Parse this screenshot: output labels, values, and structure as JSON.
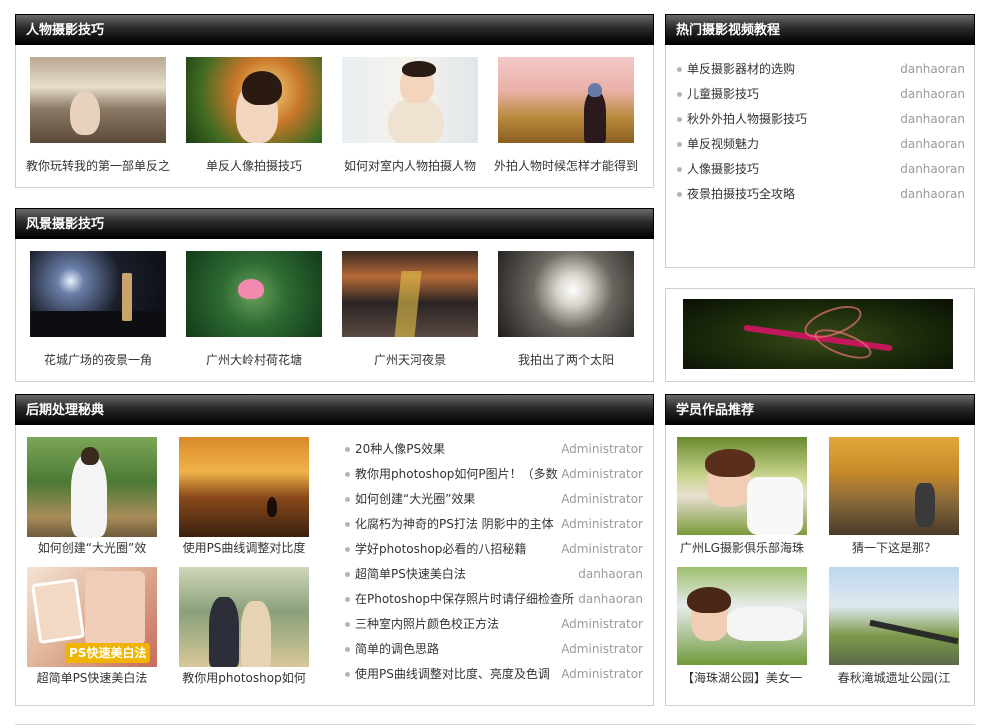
{
  "portrait": {
    "title": "人物摄影技巧",
    "items": [
      {
        "caption": "教你玩转我的第一部单反之",
        "img": "woman-on-beach-photo"
      },
      {
        "caption": "单反人像拍摄技巧",
        "img": "woman-in-autumn-leaves-photo"
      },
      {
        "caption": "如何对室内人物拍摄人物",
        "img": "woman-indoor-portrait-photo"
      },
      {
        "caption": "外拍人物时候怎样才能得到",
        "img": "woman-in-wheat-field-photo"
      }
    ]
  },
  "landscape": {
    "title": "风景摄影技巧",
    "items": [
      {
        "caption": "花城广场的夜景一角",
        "img": "city-night-square-photo"
      },
      {
        "caption": "广州大岭村荷花塘",
        "img": "lotus-pond-photo"
      },
      {
        "caption": "广州天河夜景",
        "img": "night-highway-photo"
      },
      {
        "caption": "我拍出了两个太阳",
        "img": "sun-through-clouds-photo"
      }
    ]
  },
  "postprocess": {
    "title": "后期处理秘典",
    "thumbs": [
      {
        "caption": "如何创建“大光圈”效",
        "img": "bride-in-garden-photo"
      },
      {
        "caption": "使用PS曲线调整对比度",
        "img": "sunset-beach-photo"
      },
      {
        "caption": "超简单PS快速美白法",
        "img": "ps-whitening-collage-photo",
        "overlay": "PS快速美白法"
      },
      {
        "caption": "教你用photoshop如何",
        "img": "couple-photo"
      }
    ],
    "list": [
      {
        "title": "20种人像PS效果",
        "author": "Administrator"
      },
      {
        "title": "教你用photoshop如何P图片！（多数",
        "author": "Administrator"
      },
      {
        "title": "如何创建“大光圈”效果",
        "author": "Administrator"
      },
      {
        "title": "化腐朽为神奇的PS打法 阴影中的主体",
        "author": "Administrator"
      },
      {
        "title": "学好photoshop必看的八招秘籍",
        "author": "Administrator"
      },
      {
        "title": "超简单PS快速美白法",
        "author": "danhaoran"
      },
      {
        "title": "在Photoshop中保存照片时请仔细检查所",
        "author": "danhaoran"
      },
      {
        "title": "三种室内照片颜色校正方法",
        "author": "Administrator"
      },
      {
        "title": "简单的调色思路",
        "author": "Administrator"
      },
      {
        "title": "使用PS曲线调整对比度、亮度及色调",
        "author": "Administrator"
      }
    ]
  },
  "video": {
    "title": "热门摄影视频教程",
    "list": [
      {
        "title": "单反摄影器材的选购",
        "author": "danhaoran"
      },
      {
        "title": "儿童摄影技巧",
        "author": "danhaoran"
      },
      {
        "title": "秋外外拍人物摄影技巧",
        "author": "danhaoran"
      },
      {
        "title": "单反视频魅力",
        "author": "danhaoran"
      },
      {
        "title": "人像摄影技巧",
        "author": "danhaoran"
      },
      {
        "title": "夜景拍摄技巧全攻略",
        "author": "danhaoran"
      }
    ]
  },
  "banner": {
    "img": "dragonfly-macro-photo"
  },
  "student": {
    "title": "学员作品推荐",
    "items": [
      {
        "caption": "广州LG摄影俱乐部海珠",
        "img": "woman-blowing-kiss-photo"
      },
      {
        "caption": "猜一下这是那？",
        "img": "golden-trees-photo"
      },
      {
        "caption": "【海珠湖公园】美女一",
        "img": "woman-lying-on-grass-photo"
      },
      {
        "caption": "春秋滝城遗址公园(江",
        "img": "lakeside-park-photo"
      }
    ]
  }
}
